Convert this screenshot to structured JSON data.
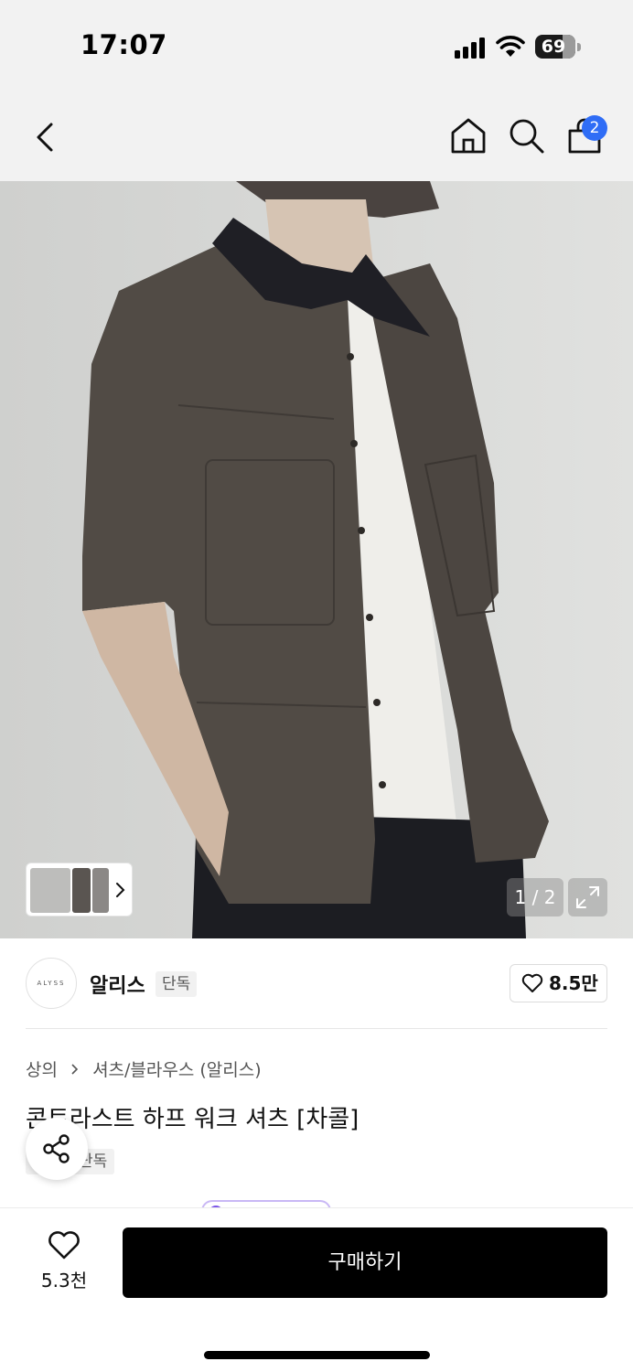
{
  "status_bar": {
    "time": "17:07",
    "battery": "69",
    "icons": [
      "signal-icon",
      "wifi-icon",
      "battery-icon"
    ]
  },
  "nav": {
    "icons": [
      "back-icon",
      "home-icon",
      "search-icon",
      "shopping-bag-icon"
    ],
    "cart_badge": "2",
    "badge_color": "#2f6df6"
  },
  "gallery": {
    "page_indicator": "1 / 2",
    "icons": [
      "chevron-right-icon",
      "expand-icon"
    ]
  },
  "brand": {
    "logo_text": "ALYSS",
    "name": "알리스",
    "tag": "단독",
    "likes": "8.5만"
  },
  "product": {
    "breadcrumb": [
      "상의",
      "셔츠/블라우스 (알리스)"
    ],
    "title": "콘트라스트 하프 워크 셔츠 [차콜]",
    "tag": "단독"
  },
  "bottom_bar": {
    "wish_count": "5.3천",
    "buy_label": "구매하기"
  },
  "colors": {
    "accent_badge": "#2f6df6",
    "buy_button": "#000000",
    "chip_purple": "#7b55e8"
  }
}
